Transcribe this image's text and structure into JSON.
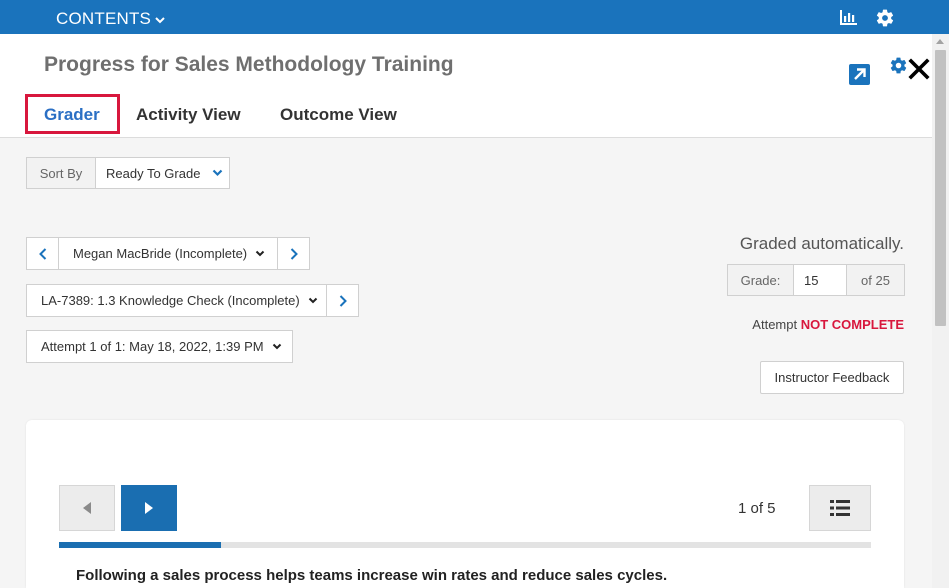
{
  "topbar": {
    "contents_label": "CONTENTS"
  },
  "header": {
    "title": "Progress for Sales Methodology Training"
  },
  "tabs": [
    {
      "label": "Grader",
      "active": true
    },
    {
      "label": "Activity View",
      "active": false
    },
    {
      "label": "Outcome View",
      "active": false
    }
  ],
  "sort": {
    "label": "Sort By",
    "selected": "Ready To Grade"
  },
  "selectors": {
    "learner": "Megan MacBride (Incomplete)",
    "activity": "LA-7389: 1.3 Knowledge Check (Incomplete)",
    "attempt": "Attempt 1 of 1: May 18, 2022, 1:39 PM"
  },
  "grading": {
    "status_text": "Graded automatically.",
    "grade_label": "Grade:",
    "grade_value": "15",
    "grade_of": "of 25",
    "attempt_label": "Attempt",
    "attempt_status": "NOT COMPLETE",
    "feedback_button": "Instructor Feedback"
  },
  "viewer": {
    "page_indicator": "1 of 5",
    "progress_fraction": 0.2,
    "question_text": "Following a sales process helps teams increase win rates and reduce sales cycles."
  },
  "colors": {
    "brand_blue": "#1a73bc",
    "active_tab": "#2a6fc4",
    "highlight_red": "#d8173d"
  }
}
